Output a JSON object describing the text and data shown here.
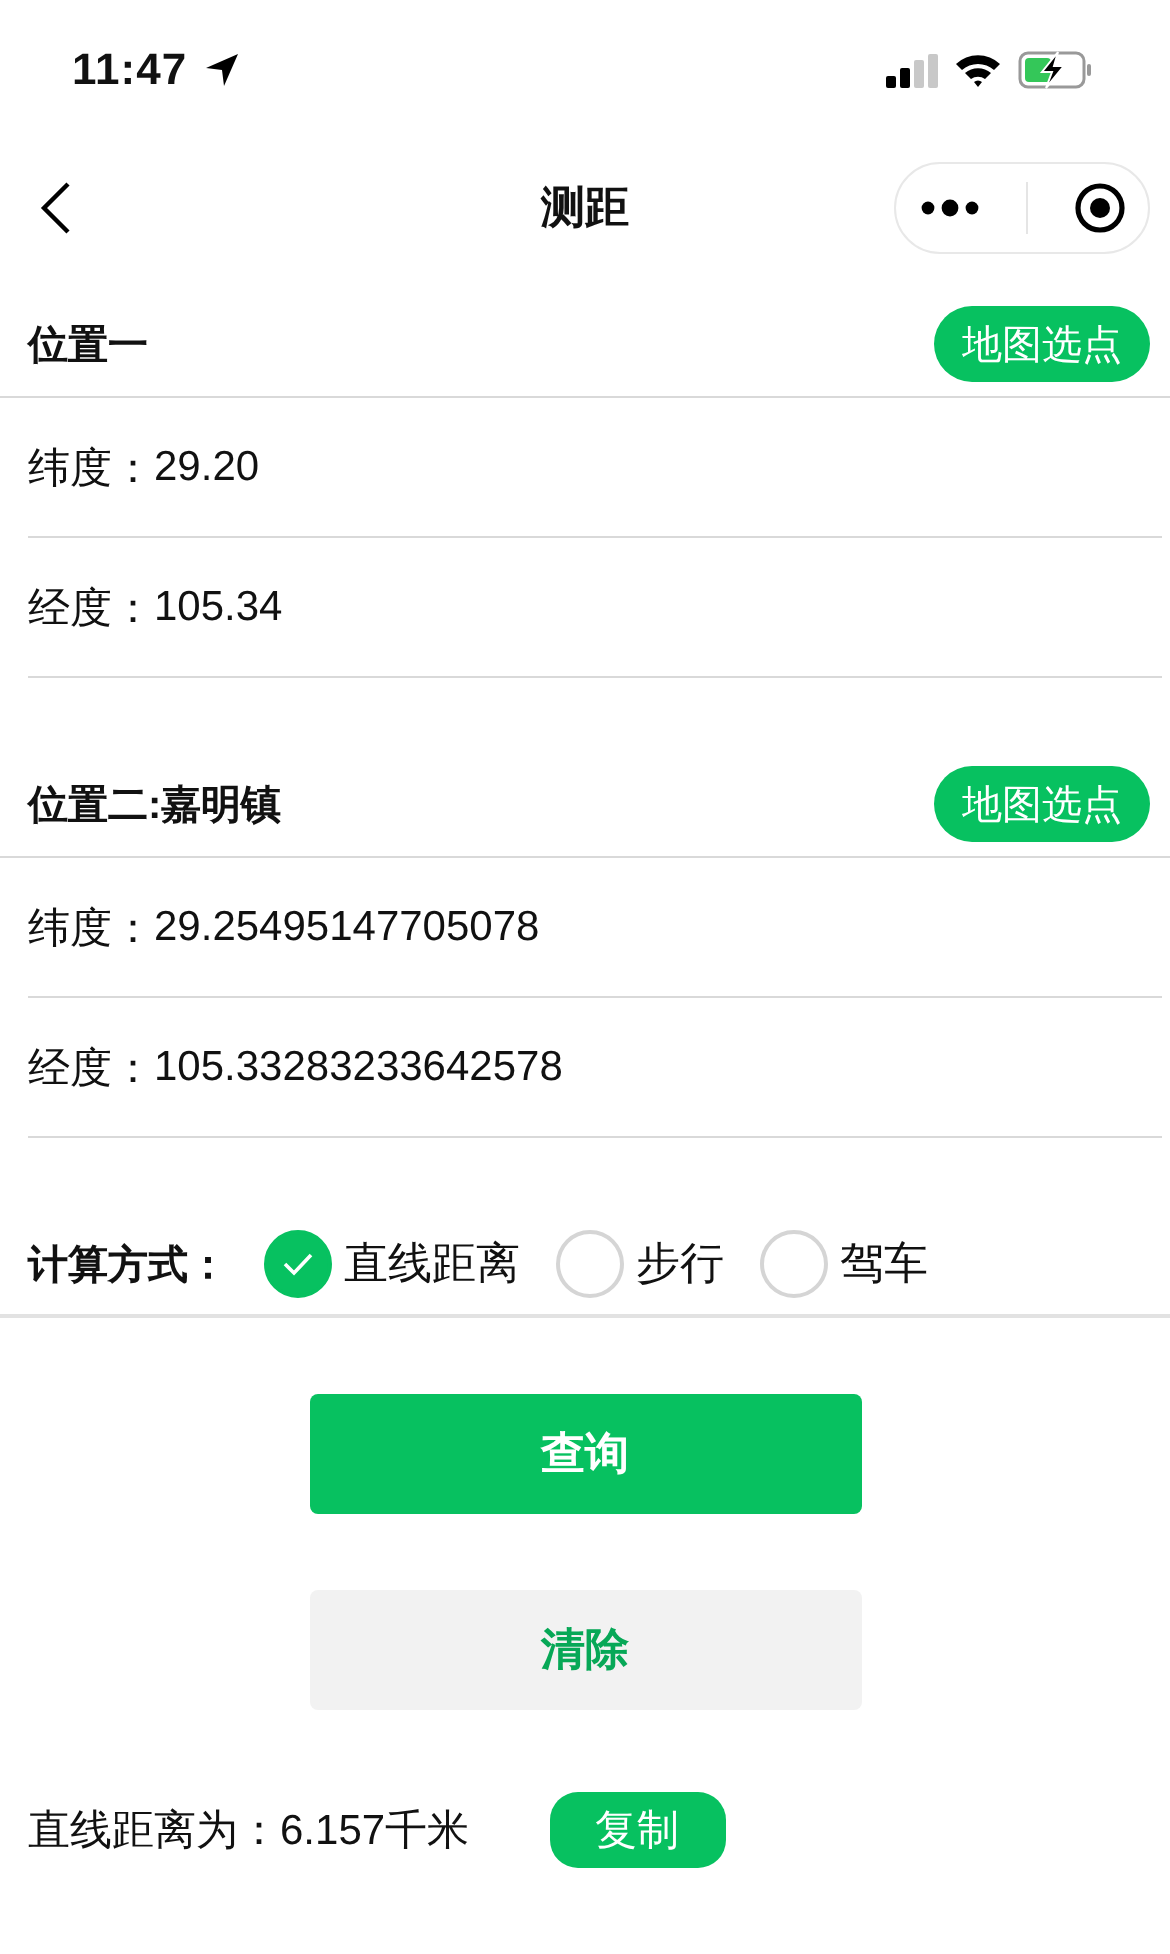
{
  "status_bar": {
    "time": "11:47"
  },
  "nav": {
    "title": "测距"
  },
  "locations": [
    {
      "title": "位置一",
      "pick_button": "地图选点",
      "fields": [
        {
          "label": "纬度：",
          "value": "29.20"
        },
        {
          "label": "经度：",
          "value": "105.34"
        }
      ]
    },
    {
      "title": "位置二:嘉明镇",
      "pick_button": "地图选点",
      "fields": [
        {
          "label": "纬度：",
          "value": "29.25495147705078"
        },
        {
          "label": "经度：",
          "value": "105.33283233642578"
        }
      ]
    }
  ],
  "mode": {
    "label": "计算方式：",
    "options": [
      {
        "label": "直线距离",
        "selected": true
      },
      {
        "label": "步行",
        "selected": false
      },
      {
        "label": "驾车",
        "selected": false
      }
    ]
  },
  "buttons": [
    {
      "label": "查询",
      "kind": "primary"
    },
    {
      "label": "清除",
      "kind": "secondary"
    }
  ],
  "result": {
    "text": "直线距离为：6.157千米",
    "copy_button": "复制"
  }
}
